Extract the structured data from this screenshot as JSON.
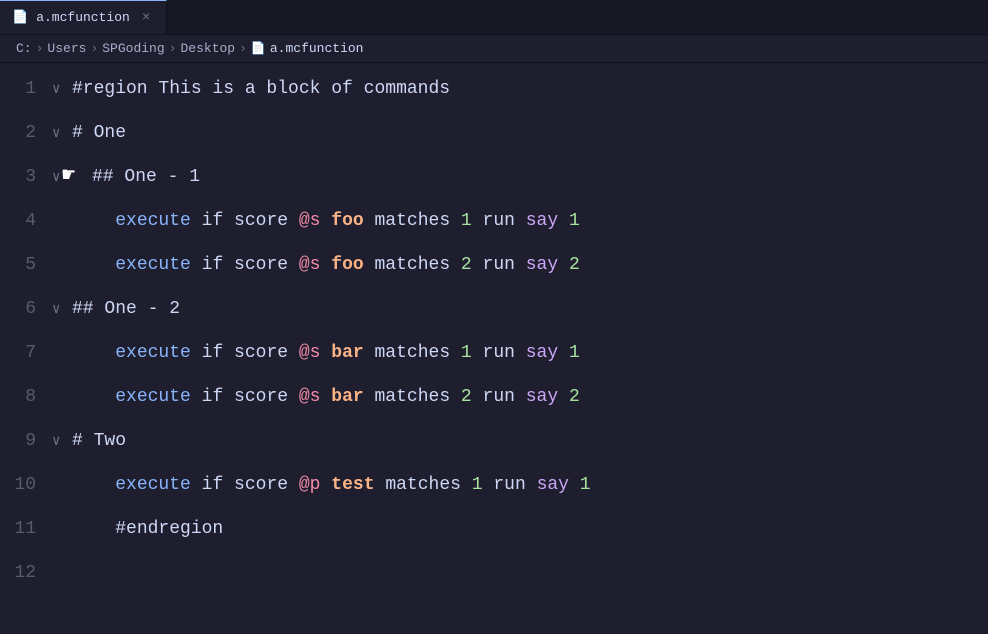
{
  "tab": {
    "icon": "📄",
    "label": "a.mcfunction",
    "close": "×"
  },
  "breadcrumb": {
    "items": [
      "C:",
      "Users",
      "SPGoding",
      "Desktop",
      "a.mcfunction"
    ]
  },
  "lines": [
    {
      "num": "1",
      "fold": "∨",
      "code_parts": [
        {
          "text": "#region This is a block ",
          "cls": "c-region"
        },
        {
          "text": "of",
          "cls": "c-region"
        },
        {
          "text": " commands",
          "cls": "c-region"
        }
      ]
    },
    {
      "num": "2",
      "fold": "∨",
      "code_parts": [
        {
          "text": "# One",
          "cls": "c-region"
        }
      ]
    },
    {
      "num": "3",
      "fold": "∨",
      "code_parts": [
        {
          "text": "## One - 1",
          "cls": "c-region"
        }
      ],
      "cursor": true
    },
    {
      "num": "4",
      "fold": "",
      "code_parts": [
        {
          "text": "    "
        },
        {
          "text": "execute",
          "cls": "c-keyword"
        },
        {
          "text": " if score "
        },
        {
          "text": "@s",
          "cls": "c-selector"
        },
        {
          "text": " "
        },
        {
          "text": "foo",
          "cls": "c-name-bold"
        },
        {
          "text": " matches "
        },
        {
          "text": "1",
          "cls": "c-num"
        },
        {
          "text": " run "
        },
        {
          "text": "say",
          "cls": "c-say"
        },
        {
          "text": " "
        },
        {
          "text": "1",
          "cls": "c-num"
        }
      ]
    },
    {
      "num": "5",
      "fold": "",
      "code_parts": [
        {
          "text": "    "
        },
        {
          "text": "execute",
          "cls": "c-keyword"
        },
        {
          "text": " if score "
        },
        {
          "text": "@s",
          "cls": "c-selector"
        },
        {
          "text": " "
        },
        {
          "text": "foo",
          "cls": "c-name-bold"
        },
        {
          "text": " matches "
        },
        {
          "text": "2",
          "cls": "c-num"
        },
        {
          "text": " run "
        },
        {
          "text": "say",
          "cls": "c-say"
        },
        {
          "text": " "
        },
        {
          "text": "2",
          "cls": "c-num"
        }
      ]
    },
    {
      "num": "6",
      "fold": "∨",
      "code_parts": [
        {
          "text": "## One - 2",
          "cls": "c-region"
        }
      ]
    },
    {
      "num": "7",
      "fold": "",
      "code_parts": [
        {
          "text": "    "
        },
        {
          "text": "execute",
          "cls": "c-keyword"
        },
        {
          "text": " if score "
        },
        {
          "text": "@s",
          "cls": "c-selector"
        },
        {
          "text": " "
        },
        {
          "text": "bar",
          "cls": "c-name-bold"
        },
        {
          "text": " matches "
        },
        {
          "text": "1",
          "cls": "c-num"
        },
        {
          "text": " run "
        },
        {
          "text": "say",
          "cls": "c-say"
        },
        {
          "text": " "
        },
        {
          "text": "1",
          "cls": "c-num"
        }
      ]
    },
    {
      "num": "8",
      "fold": "",
      "code_parts": [
        {
          "text": "    "
        },
        {
          "text": "execute",
          "cls": "c-keyword"
        },
        {
          "text": " if score "
        },
        {
          "text": "@s",
          "cls": "c-selector"
        },
        {
          "text": " "
        },
        {
          "text": "bar",
          "cls": "c-name-bold"
        },
        {
          "text": " matches "
        },
        {
          "text": "2",
          "cls": "c-num"
        },
        {
          "text": " run "
        },
        {
          "text": "say",
          "cls": "c-say"
        },
        {
          "text": " "
        },
        {
          "text": "2",
          "cls": "c-num"
        }
      ]
    },
    {
      "num": "9",
      "fold": "∨",
      "code_parts": [
        {
          "text": "# Two",
          "cls": "c-region"
        }
      ]
    },
    {
      "num": "10",
      "fold": "",
      "code_parts": [
        {
          "text": "    "
        },
        {
          "text": "execute",
          "cls": "c-keyword"
        },
        {
          "text": " if score "
        },
        {
          "text": "@p",
          "cls": "c-selector"
        },
        {
          "text": " "
        },
        {
          "text": "test",
          "cls": "c-name-bold"
        },
        {
          "text": " matches "
        },
        {
          "text": "1",
          "cls": "c-num"
        },
        {
          "text": " run "
        },
        {
          "text": "say",
          "cls": "c-say"
        },
        {
          "text": " "
        },
        {
          "text": "1",
          "cls": "c-num"
        }
      ]
    },
    {
      "num": "11",
      "fold": "",
      "code_parts": [
        {
          "text": "    "
        },
        {
          "text": "#endregion",
          "cls": "c-region"
        }
      ]
    },
    {
      "num": "12",
      "fold": "",
      "code_parts": []
    }
  ]
}
